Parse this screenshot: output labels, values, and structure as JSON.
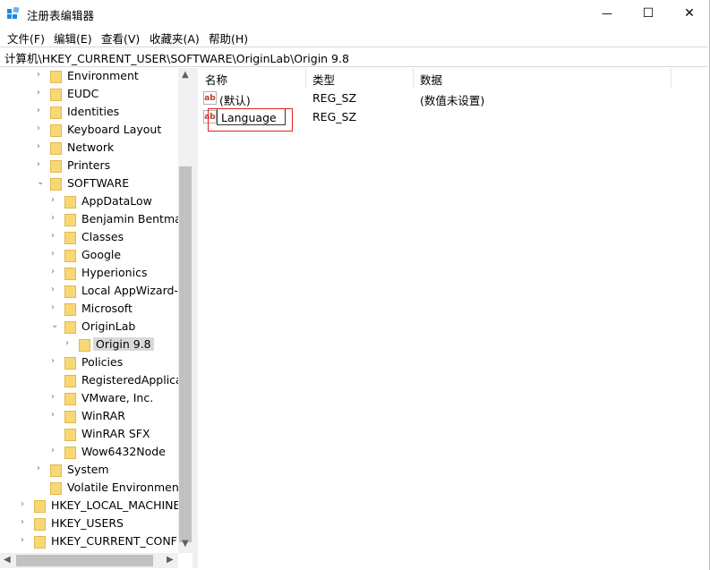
{
  "window": {
    "title": "注册表编辑器",
    "minimize_glyph": "—",
    "maximize_glyph": "☐",
    "close_glyph": "✕"
  },
  "menu": [
    "文件(F)",
    "编辑(E)",
    "查看(V)",
    "收藏夹(A)",
    "帮助(H)"
  ],
  "address": "计算机\\HKEY_CURRENT_USER\\SOFTWARE\\OriginLab\\Origin 9.8",
  "tree": [
    {
      "label": "Environment",
      "level": 1,
      "chev": "›"
    },
    {
      "label": "EUDC",
      "level": 1,
      "chev": "›"
    },
    {
      "label": "Identities",
      "level": 1,
      "chev": "›"
    },
    {
      "label": "Keyboard Layout",
      "level": 1,
      "chev": "›"
    },
    {
      "label": "Network",
      "level": 1,
      "chev": "›"
    },
    {
      "label": "Printers",
      "level": 1,
      "chev": "›"
    },
    {
      "label": "SOFTWARE",
      "level": 1,
      "chev": "⌄"
    },
    {
      "label": "AppDataLow",
      "level": 2,
      "chev": "›"
    },
    {
      "label": "Benjamin Bentman",
      "level": 2,
      "chev": "›"
    },
    {
      "label": "Classes",
      "level": 2,
      "chev": "›"
    },
    {
      "label": "Google",
      "level": 2,
      "chev": "›"
    },
    {
      "label": "Hyperionics",
      "level": 2,
      "chev": "›"
    },
    {
      "label": "Local AppWizard-Ge",
      "level": 2,
      "chev": "›"
    },
    {
      "label": "Microsoft",
      "level": 2,
      "chev": "›"
    },
    {
      "label": "OriginLab",
      "level": 2,
      "chev": "⌄"
    },
    {
      "label": "Origin 9.8",
      "level": 3,
      "chev": "›",
      "selected": true
    },
    {
      "label": "Policies",
      "level": 2,
      "chev": "›"
    },
    {
      "label": "RegisteredApplicati",
      "level": 2,
      "chev": ""
    },
    {
      "label": "VMware, Inc.",
      "level": 2,
      "chev": "›"
    },
    {
      "label": "WinRAR",
      "level": 2,
      "chev": "›"
    },
    {
      "label": "WinRAR SFX",
      "level": 2,
      "chev": ""
    },
    {
      "label": "Wow6432Node",
      "level": 2,
      "chev": "›"
    },
    {
      "label": "System",
      "level": 1,
      "chev": "›"
    },
    {
      "label": "Volatile Environment",
      "level": 1,
      "chev": ""
    },
    {
      "label": "HKEY_LOCAL_MACHINE",
      "level": 0,
      "chev": "›"
    },
    {
      "label": "HKEY_USERS",
      "level": 0,
      "chev": "›"
    },
    {
      "label": "HKEY_CURRENT_CONFIG",
      "level": 0,
      "chev": "›"
    }
  ],
  "columns": {
    "name": "名称",
    "type": "类型",
    "data": "数据"
  },
  "values": [
    {
      "name": "(默认)",
      "type": "REG_SZ",
      "data": "(数值未设置)"
    },
    {
      "name": "Language",
      "type": "REG_SZ",
      "data": "",
      "editing": true
    }
  ],
  "icons": {
    "value_icon": "ab",
    "folder": "folder-icon"
  },
  "colors": {
    "folder": "#f8d775",
    "highlight": "#e02020",
    "selected": "#d9d9d9"
  }
}
